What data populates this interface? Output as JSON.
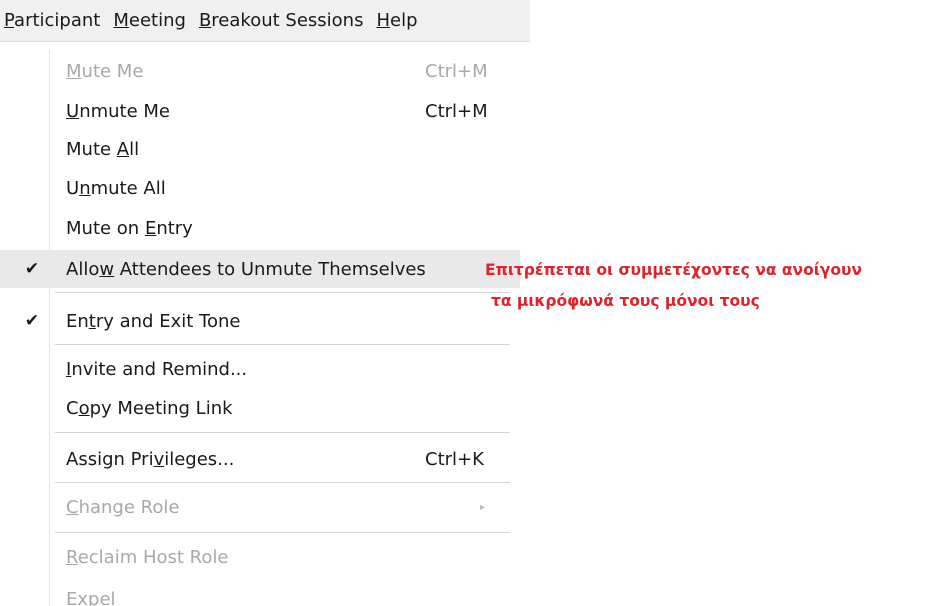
{
  "menubar": {
    "items": [
      {
        "pre": "",
        "ul": "P",
        "post": "articipant"
      },
      {
        "pre": "",
        "ul": "M",
        "post": "eeting"
      },
      {
        "pre": "",
        "ul": "B",
        "post": "reakout Sessions"
      },
      {
        "pre": "",
        "ul": "H",
        "post": "elp"
      }
    ]
  },
  "menu": {
    "mute_me": {
      "pre": "",
      "ul": "M",
      "post": "ute Me",
      "shortcut": "Ctrl+M"
    },
    "unmute_me": {
      "pre": "",
      "ul": "U",
      "post": "nmute Me",
      "shortcut": "Ctrl+M"
    },
    "mute_all": {
      "pre": "Mute ",
      "ul": "A",
      "post": "ll"
    },
    "unmute_all": {
      "pre": "U",
      "ul": "n",
      "post": "mute All"
    },
    "mute_on_entry": {
      "pre": "Mute on ",
      "ul": "E",
      "post": "ntry"
    },
    "allow_unmute": {
      "pre": "Allo",
      "ul": "w",
      "post": " Attendees to Unmute Themselves",
      "check": "✔"
    },
    "entry_exit_tone": {
      "pre": "En",
      "ul": "t",
      "post": "ry and Exit Tone",
      "check": "✔"
    },
    "invite_remind": {
      "pre": "",
      "ul": "I",
      "post": "nvite and Remind..."
    },
    "copy_link": {
      "pre": "C",
      "ul": "o",
      "post": "py Meeting Link"
    },
    "assign_privileges": {
      "pre": "Assign Pri",
      "ul": "v",
      "post": "ileges...",
      "shortcut": "Ctrl+K"
    },
    "change_role": {
      "pre": "",
      "ul": "C",
      "post": "hange Role",
      "arrow": "▸"
    },
    "reclaim_host": {
      "pre": "",
      "ul": "R",
      "post": "eclaim Host Role"
    },
    "expel": {
      "pre": "",
      "ul": "",
      "post": "Expel"
    }
  },
  "annotation": {
    "line1": "Επιτρέπεται οι συμμετέχοντες να ανοίγουν",
    "line2": "τα μικρόφωνά τους μόνοι τους"
  },
  "colors": {
    "annotation": "#e0232a",
    "highlight": "#e9e9e9",
    "disabled": "#a8a8a8"
  }
}
